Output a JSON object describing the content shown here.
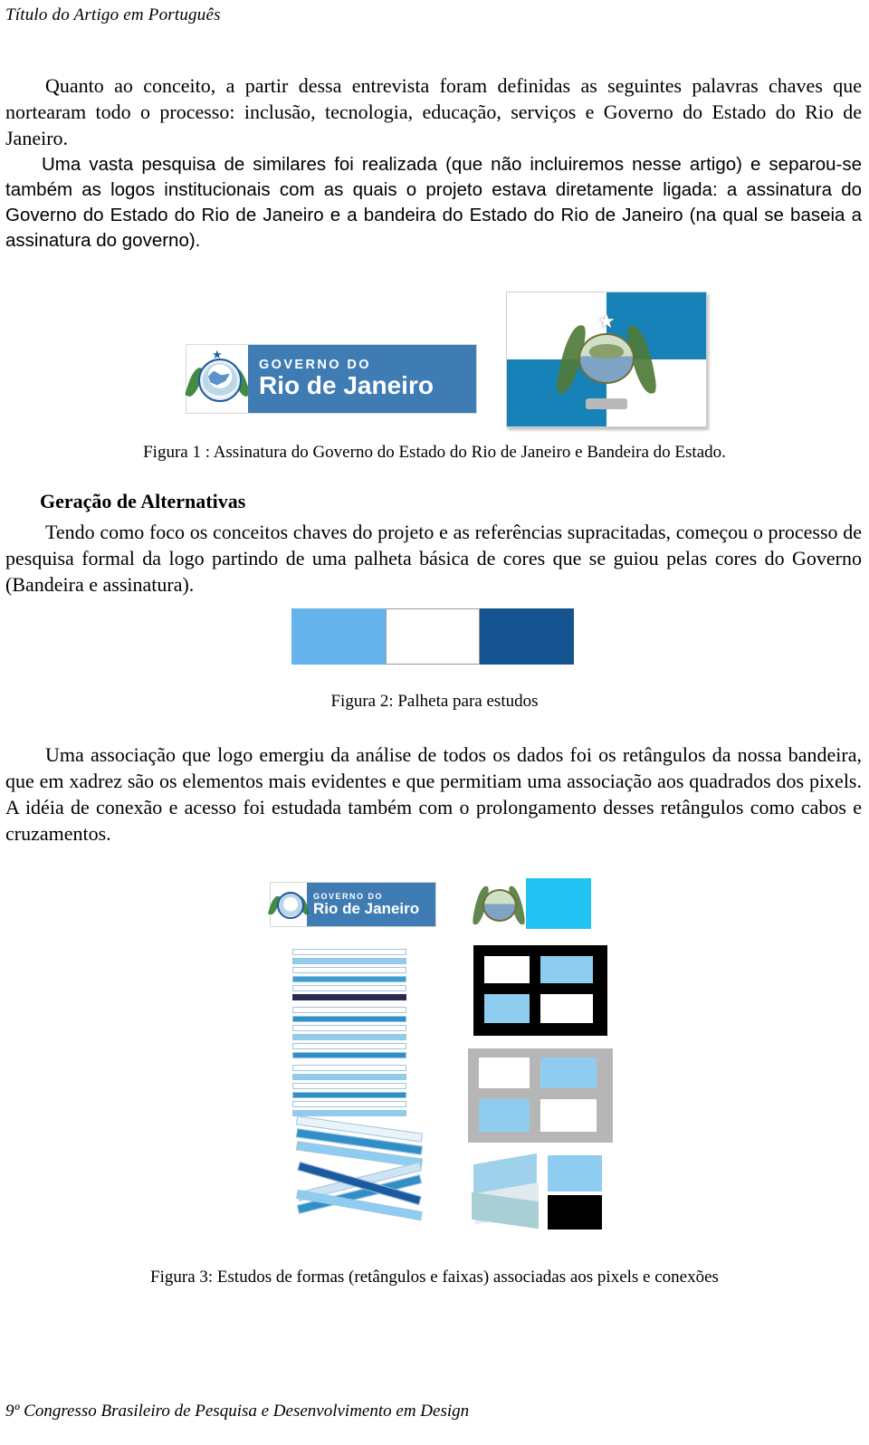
{
  "document": {
    "running_head": "Título do Artigo em Português",
    "footer": "9º Congresso Brasileiro de Pesquisa e Desenvolvimento em Design",
    "paragraphs": {
      "p1": "Quanto ao conceito, a partir dessa entrevista foram definidas as seguintes palavras chaves que nortearam todo o processo: inclusão, tecnologia, educação, serviços e Governo do Estado do Rio de Janeiro.",
      "p2": "Uma vasta pesquisa de similares foi realizada (que não incluiremos nesse artigo) e separou-se também as logos institucionais com as quais o projeto estava diretamente ligada: a assinatura do Governo do Estado do Rio de Janeiro e a bandeira do Estado do Rio de Janeiro (na qual se baseia a assinatura do governo).",
      "p3": "Tendo como foco os conceitos chaves do projeto e as referências supracitadas, começou o processo de pesquisa formal da logo partindo de uma palheta básica de cores que se guiou pelas cores do Governo (Bandeira e assinatura).",
      "p4": "Uma associação que logo emergiu da análise de todos os dados foi os retângulos da nossa bandeira, que em xadrez são os elementos mais evidentes e que permitiam uma associação aos quadrados dos pixels. A idéia de conexão e acesso foi estudada também com o prolongamento desses retângulos como cabos e cruzamentos."
    },
    "section_heading": "Geração de Alternativas",
    "captions": {
      "fig1": "Figura 1 : Assinatura do Governo do Estado do Rio de Janeiro e Bandeira do Estado.",
      "fig2": "Figura 2: Palheta para estudos",
      "fig3": "Figura 3: Estudos de formas (retângulos e faixas) associadas aos pixels e conexões"
    },
    "figures": {
      "gov_signature": {
        "line1": "GOVERNO DO",
        "line2": "Rio de Janeiro",
        "bar_color": "#3f7cb4"
      },
      "flag": {
        "blue": "#1782b8",
        "white": "#ffffff"
      },
      "palette": {
        "swatches": [
          {
            "name": "azul-claro",
            "color": "#64b3ec"
          },
          {
            "name": "branco",
            "color": "#ffffff"
          },
          {
            "name": "azul-escuro",
            "color": "#14538f"
          }
        ]
      },
      "studies": {
        "mini_logo_line1": "GOVERNO DO",
        "mini_logo_line2": "Rio de Janeiro",
        "accent_cyan": "#22c3f3",
        "accent_black": "#000000",
        "accent_grey": "#b6b6b6"
      }
    }
  }
}
